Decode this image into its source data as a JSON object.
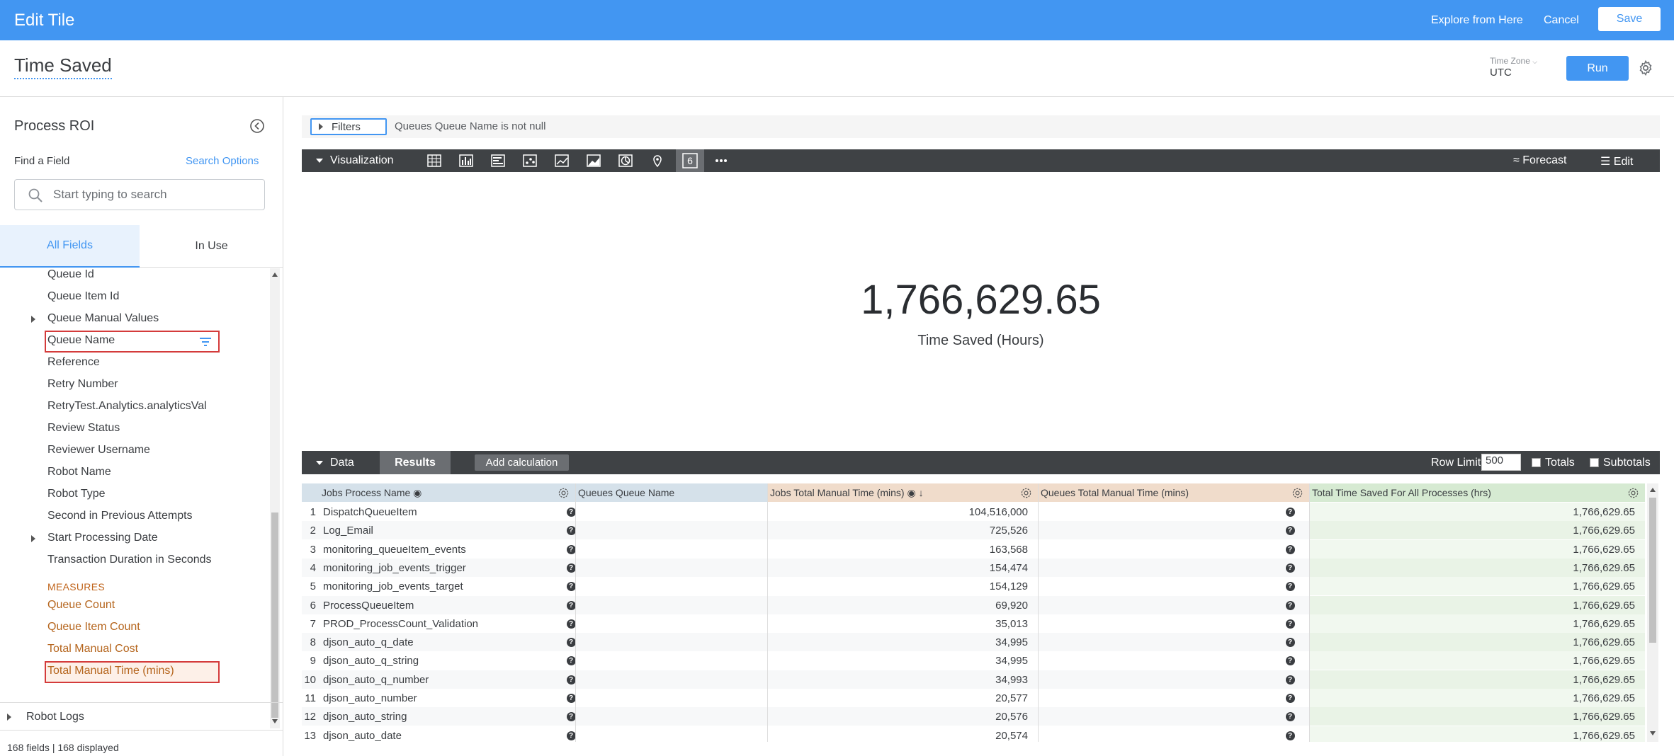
{
  "topbar": {
    "title": "Edit Tile",
    "explore_label": "Explore from Here",
    "cancel_label": "Cancel",
    "save_label": "Save",
    "color": "#4296f2"
  },
  "header": {
    "tile_title": "Time Saved",
    "timezone_label": "Time Zone",
    "timezone_value": "UTC",
    "run_label": "Run"
  },
  "sidebar": {
    "explore_title": "Process ROI",
    "find_label": "Find a Field",
    "search_options_label": "Search Options",
    "search_placeholder": "Start typing to search",
    "tabs": [
      "All Fields",
      "In Use"
    ],
    "fields": [
      {
        "label": "Queue Id",
        "expandable": false
      },
      {
        "label": "Queue Item Id",
        "expandable": false
      },
      {
        "label": "Queue Manual Values",
        "expandable": true
      },
      {
        "label": "Queue Name",
        "expandable": false,
        "highlighted": true,
        "filtered": true
      },
      {
        "label": "Reference",
        "expandable": false
      },
      {
        "label": "Retry Number",
        "expandable": false
      },
      {
        "label": "RetryTest.Analytics.analyticsVal",
        "expandable": false
      },
      {
        "label": "Review Status",
        "expandable": false
      },
      {
        "label": "Reviewer Username",
        "expandable": false
      },
      {
        "label": "Robot Name",
        "expandable": false
      },
      {
        "label": "Robot Type",
        "expandable": false
      },
      {
        "label": "Second in Previous Attempts",
        "expandable": false
      },
      {
        "label": "Start Processing Date",
        "expandable": true
      },
      {
        "label": "Transaction Duration in Seconds",
        "expandable": false
      }
    ],
    "measures_header": "MEASURES",
    "measures": [
      {
        "label": "Queue Count"
      },
      {
        "label": "Queue Item Count"
      },
      {
        "label": "Total Manual Cost"
      },
      {
        "label": "Total Manual Time (mins)",
        "highlighted": true
      }
    ],
    "group_label": "Robot Logs",
    "footer": "168 fields | 168 displayed"
  },
  "filters": {
    "button_label": "Filters",
    "summary": "Queues Queue Name is not null"
  },
  "visualization": {
    "label": "Visualization",
    "icons": [
      "table-icon",
      "column-chart-icon",
      "bar-chart-icon",
      "scatter-icon",
      "line-chart-icon",
      "area-chart-icon",
      "pie-chart-icon",
      "map-pin-icon",
      "single-value-icon",
      "more-icon"
    ],
    "active_icon": "single-value-icon",
    "forecast_label": "Forecast",
    "edit_label": "Edit",
    "single_value": "1,766,629.65",
    "single_value_label": "Time Saved (Hours)"
  },
  "data_panel": {
    "label": "Data",
    "results_label": "Results",
    "add_calc_label": "Add calculation",
    "row_limit_label": "Row Limit",
    "row_limit_value": "500",
    "totals_label": "Totals",
    "subtotals_label": "Subtotals"
  },
  "table": {
    "columns": [
      "Jobs Process Name",
      "Queues Queue Name",
      "Jobs Total Manual Time (mins)",
      "Queues Total Manual Time (mins)",
      "Total Time Saved For All Processes (hrs)"
    ],
    "null_symbol": "?",
    "rows": [
      {
        "n": "1",
        "process": "DispatchQueueItem",
        "jobs_time": "104,516,000",
        "total": "1,766,629.65"
      },
      {
        "n": "2",
        "process": "Log_Email",
        "jobs_time": "725,526",
        "total": "1,766,629.65"
      },
      {
        "n": "3",
        "process": "monitoring_queueItem_events",
        "jobs_time": "163,568",
        "total": "1,766,629.65"
      },
      {
        "n": "4",
        "process": "monitoring_job_events_trigger",
        "jobs_time": "154,474",
        "total": "1,766,629.65"
      },
      {
        "n": "5",
        "process": "monitoring_job_events_target",
        "jobs_time": "154,129",
        "total": "1,766,629.65"
      },
      {
        "n": "6",
        "process": "ProcessQueueItem",
        "jobs_time": "69,920",
        "total": "1,766,629.65"
      },
      {
        "n": "7",
        "process": "PROD_ProcessCount_Validation",
        "jobs_time": "35,013",
        "total": "1,766,629.65"
      },
      {
        "n": "8",
        "process": "djson_auto_q_date",
        "jobs_time": "34,995",
        "total": "1,766,629.65"
      },
      {
        "n": "9",
        "process": "djson_auto_q_string",
        "jobs_time": "34,995",
        "total": "1,766,629.65"
      },
      {
        "n": "10",
        "process": "djson_auto_q_number",
        "jobs_time": "34,993",
        "total": "1,766,629.65"
      },
      {
        "n": "11",
        "process": "djson_auto_number",
        "jobs_time": "20,577",
        "total": "1,766,629.65"
      },
      {
        "n": "12",
        "process": "djson_auto_string",
        "jobs_time": "20,576",
        "total": "1,766,629.65"
      },
      {
        "n": "13",
        "process": "djson_auto_date",
        "jobs_time": "20,574",
        "total": "1,766,629.65"
      }
    ]
  }
}
